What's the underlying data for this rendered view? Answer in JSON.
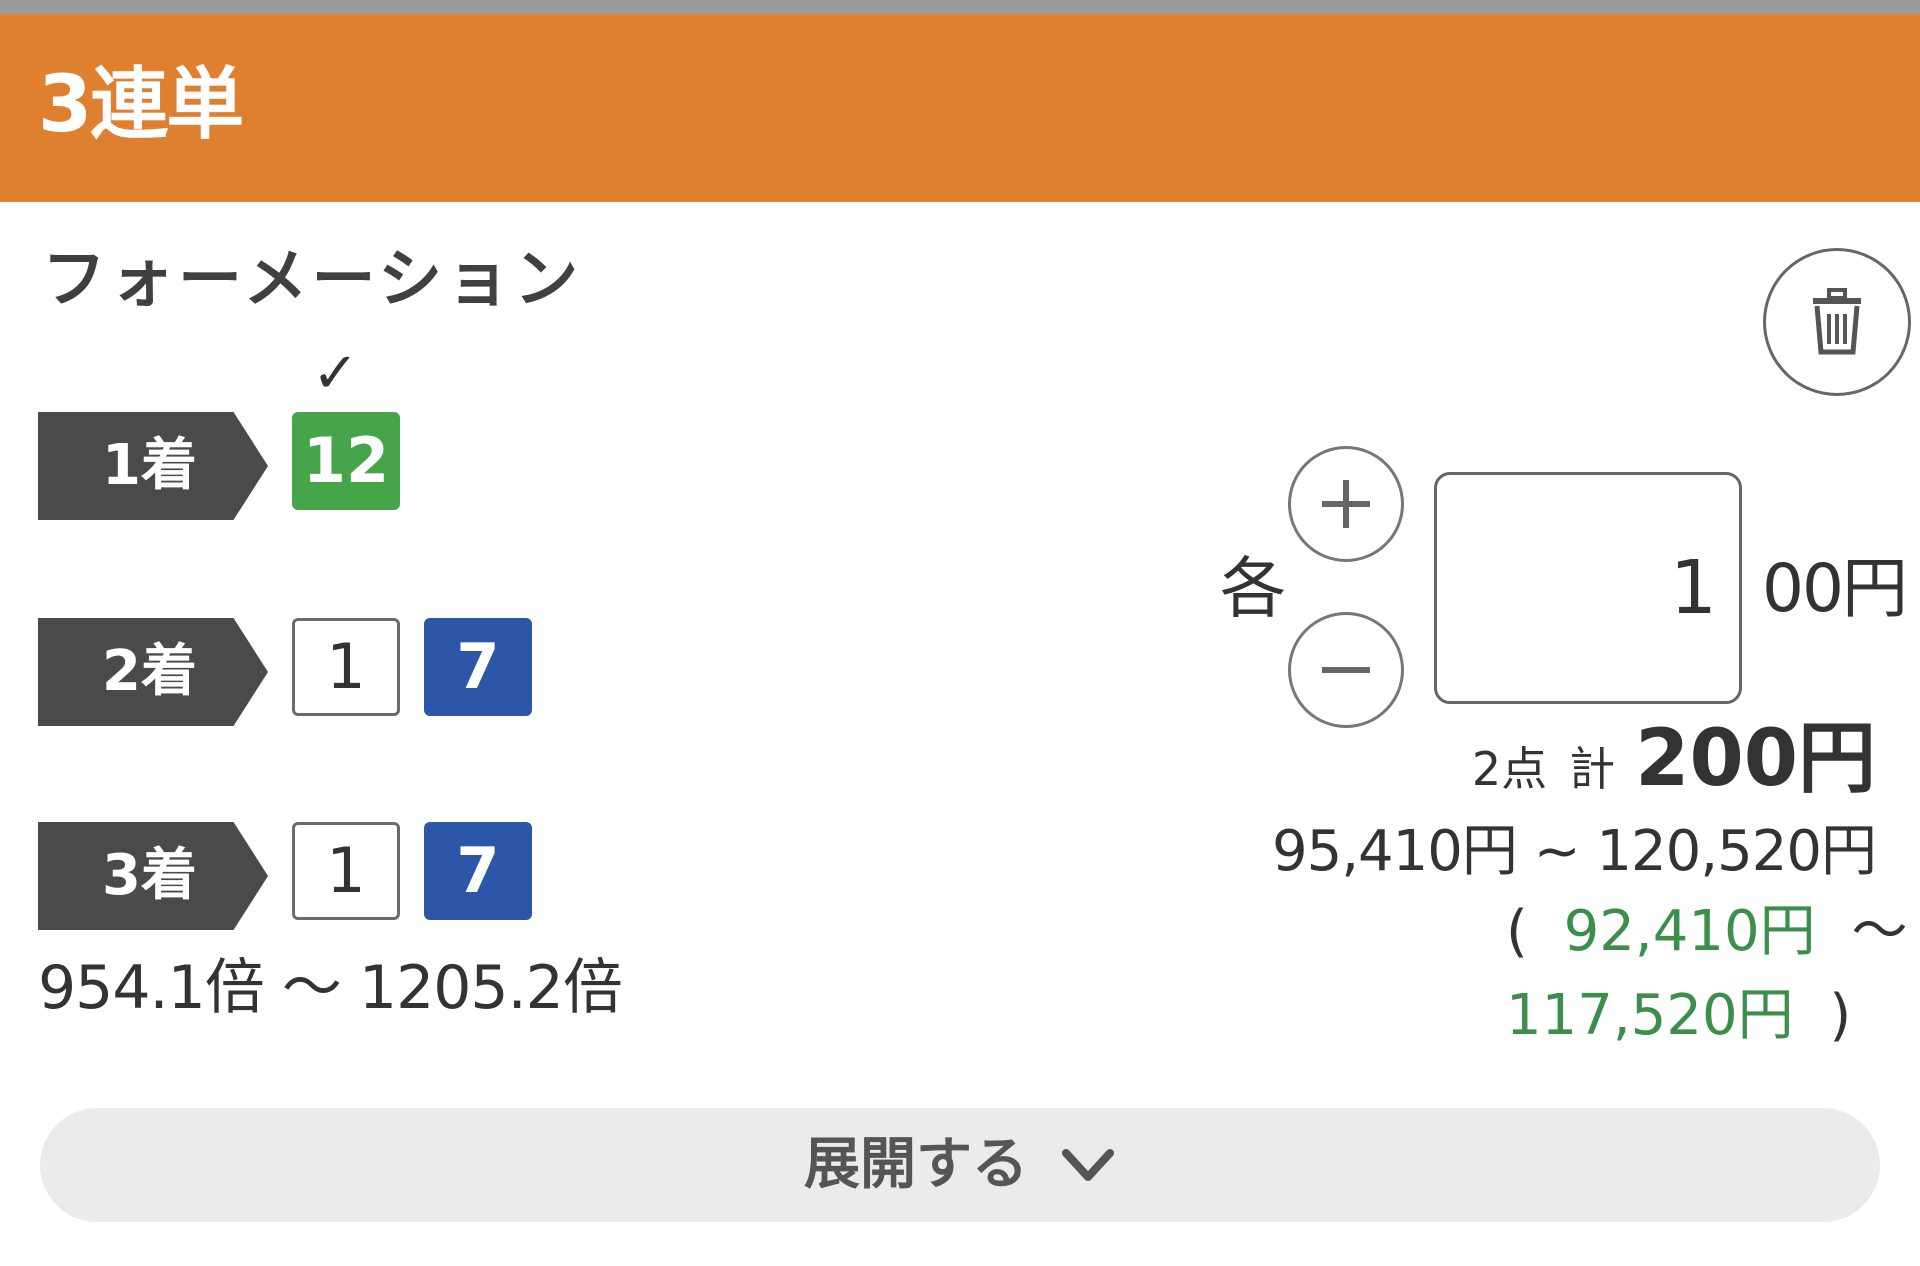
{
  "header": {
    "title": "3連単"
  },
  "bet": {
    "type": "フォーメーション",
    "rows": [
      {
        "label": "1着",
        "numbers": [
          {
            "value": "12",
            "style": "green"
          }
        ]
      },
      {
        "label": "2着",
        "numbers": [
          {
            "value": "1",
            "style": "white"
          },
          {
            "value": "7",
            "style": "blue"
          }
        ]
      },
      {
        "label": "3着",
        "numbers": [
          {
            "value": "1",
            "style": "white"
          },
          {
            "value": "7",
            "style": "blue"
          }
        ]
      }
    ],
    "check_mark": "✓",
    "odds_range": "954.1倍 ～ 1205.2倍"
  },
  "amount": {
    "each_label": "各",
    "value": "1",
    "unit": "00円",
    "plus_icon": "plus-icon",
    "minus_icon": "minus-icon"
  },
  "summary": {
    "points": "2点",
    "total_label": "計",
    "total": "200円",
    "payout_range": "95,410円 ~ 120,520円",
    "open_paren": "(",
    "net_min": "92,410円",
    "tilde": "～",
    "net_max": "117,520円",
    "close_paren": ")"
  },
  "expand": {
    "label": "展開する",
    "icon": "chevron-down-icon"
  },
  "trash": {
    "icon": "trash-icon"
  },
  "colors": {
    "header_bg": "#df8031",
    "green_badge": "#45a548",
    "blue_badge": "#2c56a8",
    "net_text": "#3c8f4a",
    "label_bg": "#4a4a4a"
  }
}
